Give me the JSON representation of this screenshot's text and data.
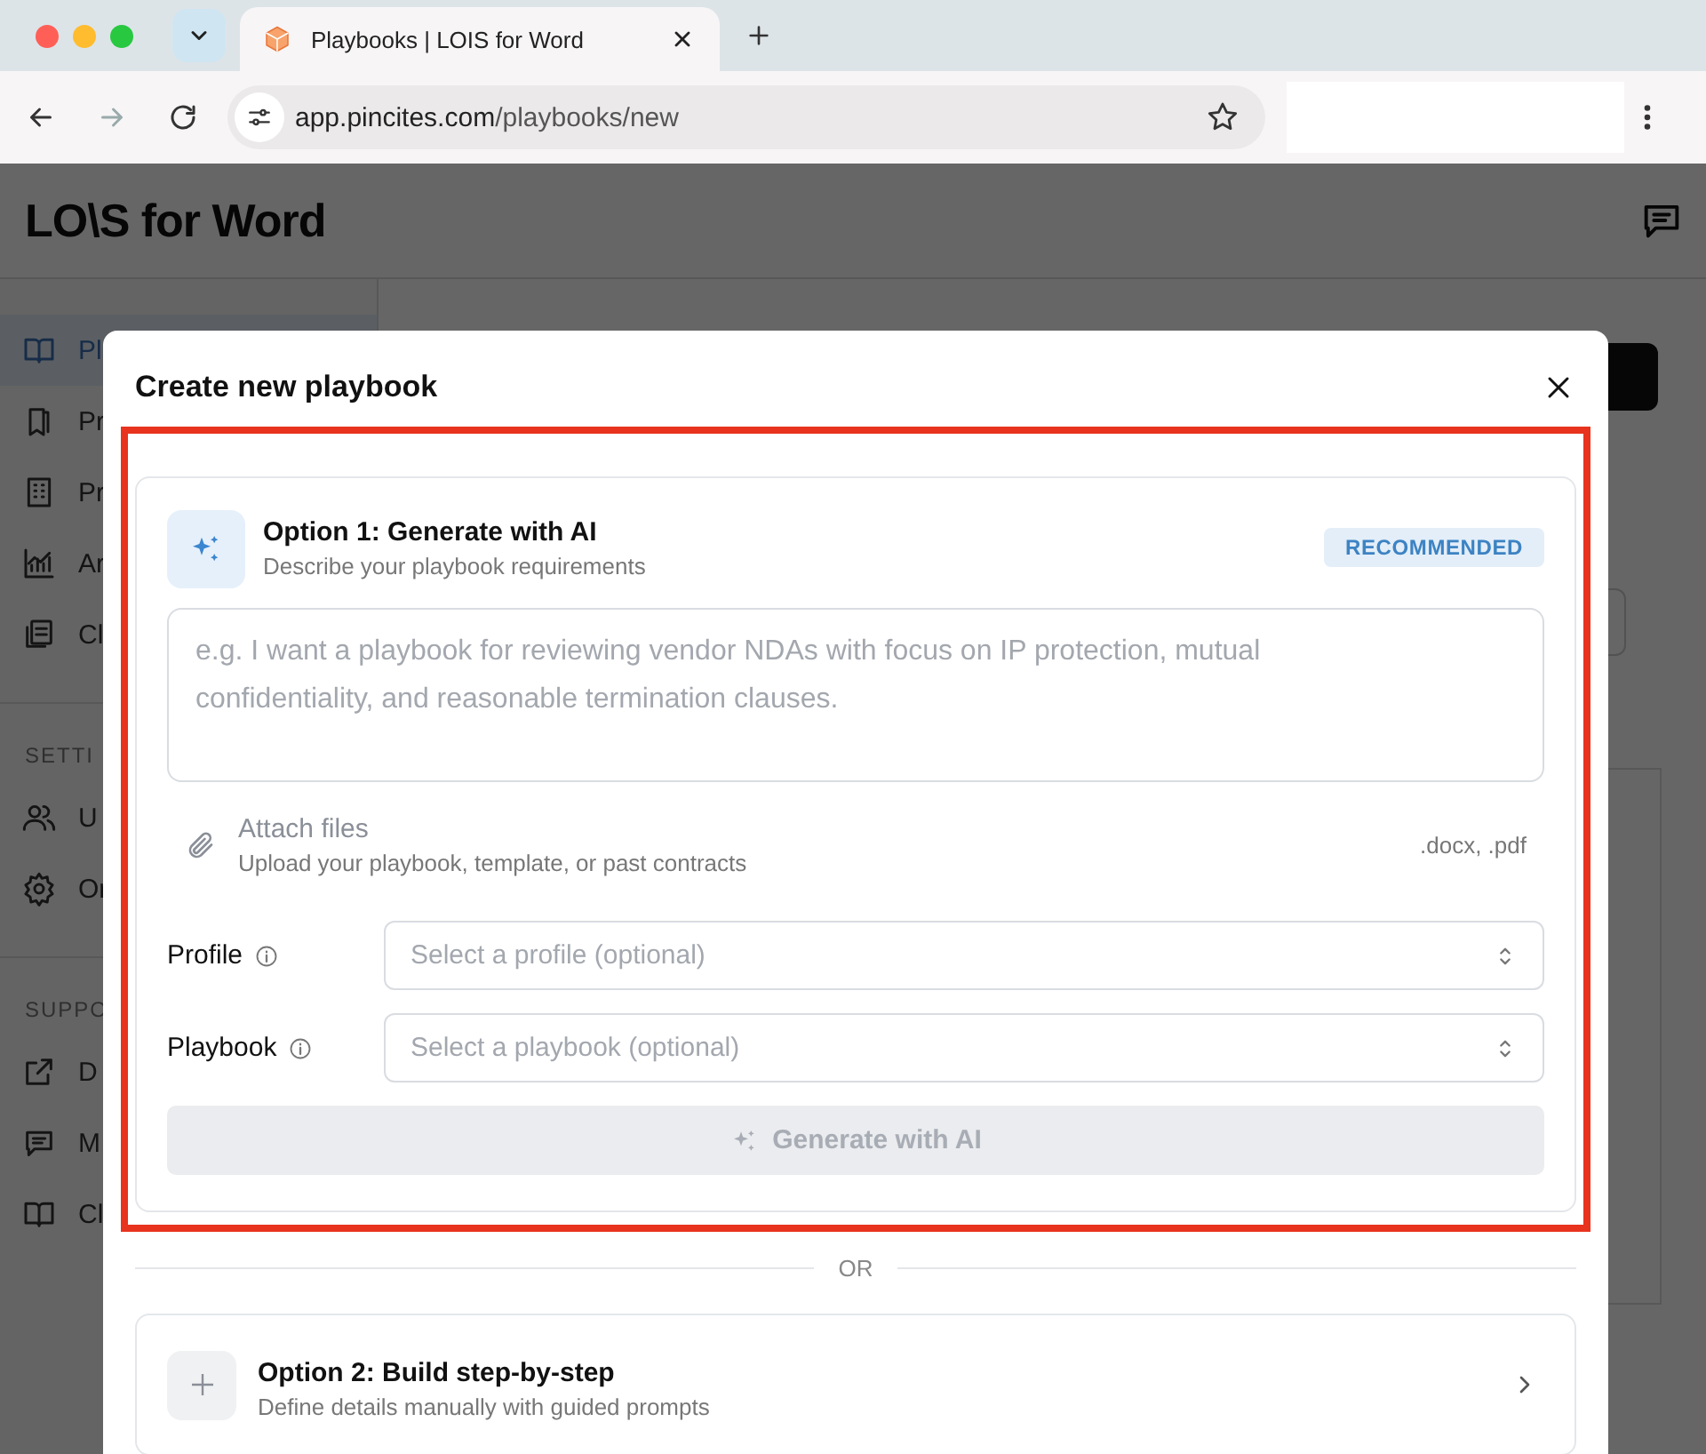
{
  "browser": {
    "tab_title": "Playbooks | LOIS for Word",
    "url_host": "app.pincites.com",
    "url_path": "/playbooks/new"
  },
  "app": {
    "logo": "LO\\S for Word"
  },
  "sidebar": {
    "sections": [
      {
        "items": [
          {
            "label": "Pl",
            "selected": true
          },
          {
            "label": "Pr",
            "selected": false
          },
          {
            "label": "Pr",
            "selected": false
          },
          {
            "label": "Ar",
            "selected": false
          },
          {
            "label": "Cl",
            "selected": false
          }
        ]
      },
      {
        "heading": "SETTI",
        "items": [
          {
            "label": "U",
            "selected": false
          },
          {
            "label": "Or",
            "selected": false
          }
        ]
      },
      {
        "heading": "SUPPO",
        "items": [
          {
            "label": "D",
            "selected": false
          },
          {
            "label": "M",
            "selected": false
          },
          {
            "label": "Cl",
            "selected": false
          }
        ]
      }
    ]
  },
  "dialog": {
    "title": "Create new playbook",
    "option1": {
      "title": "Option 1: Generate with AI",
      "subtitle": "Describe your playbook requirements",
      "badge": "RECOMMENDED",
      "prompt": {
        "placeholder": "e.g. I want a playbook for reviewing vendor NDAs with focus on IP protection, mutual confidentiality, and reasonable termination clauses."
      },
      "attach": {
        "title": "Attach files",
        "subtitle": "Upload your playbook, template, or past contracts",
        "types": ".docx, .pdf"
      },
      "fields": [
        {
          "label": "Profile",
          "placeholder": "Select a profile (optional)"
        },
        {
          "label": "Playbook",
          "placeholder": "Select a playbook (optional)"
        }
      ],
      "generate_button": {
        "label": "Generate with AI",
        "disabled": true
      }
    },
    "divider": "OR",
    "option2": {
      "title": "Option 2: Build step-by-step",
      "subtitle": "Define details manually with guided prompts"
    }
  }
}
